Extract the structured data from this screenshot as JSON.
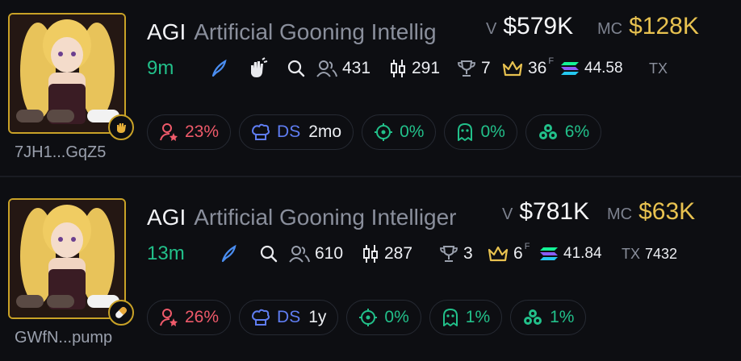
{
  "colors": {
    "background": "#0d0e12",
    "accent_gold": "#e8c250",
    "green": "#22c08a",
    "red": "#ef5a6a",
    "blue": "#5f7df2"
  },
  "tokens": [
    {
      "ticker": "AGI",
      "name": "Artificial Gooning Intellig",
      "volume_label": "V",
      "volume": "$579K",
      "mc_label": "MC",
      "market_cap": "$128K",
      "age": "9m",
      "holders": "431",
      "trades": "291",
      "top_holders": "7",
      "crown_count": "36",
      "f_label": "F",
      "sol_amount": "44.58",
      "tx_label": "TX",
      "tx_value": "",
      "address": "7JH1...GqZ5",
      "badge_icon": "hand-icon",
      "pills": {
        "top10": "23%",
        "ds_label": "DS",
        "ds_age": "2mo",
        "snipers": "0%",
        "insiders": "0%",
        "bundlers": "6%"
      }
    },
    {
      "ticker": "AGI",
      "name": "Artificial Gooning Intelliger",
      "volume_label": "V",
      "volume": "$781K",
      "mc_label": "MC",
      "market_cap": "$63K",
      "age": "13m",
      "holders": "610",
      "trades": "287",
      "top_holders": "3",
      "crown_count": "6",
      "f_label": "F",
      "sol_amount": "41.84",
      "tx_label": "TX",
      "tx_value": "7432",
      "address": "GWfN...pump",
      "badge_icon": "pill-icon",
      "pills": {
        "top10": "26%",
        "ds_label": "DS",
        "ds_age": "1y",
        "snipers": "0%",
        "insiders": "1%",
        "bundlers": "1%"
      }
    }
  ]
}
